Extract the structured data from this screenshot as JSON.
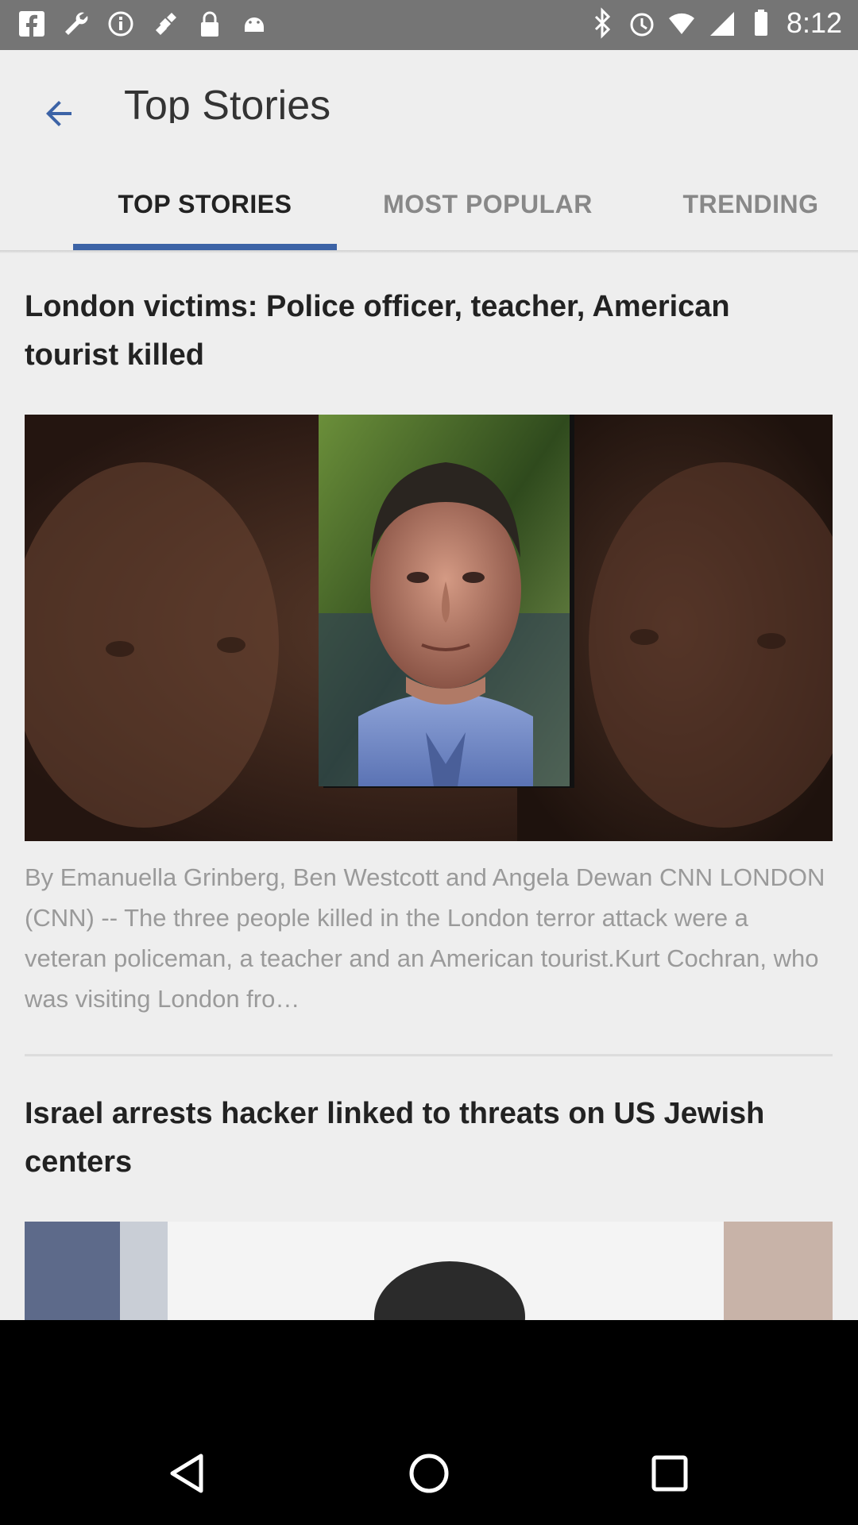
{
  "status_bar": {
    "time": "8:12",
    "left_icons": [
      "facebook-icon",
      "wrench-icon",
      "info-icon",
      "fake-gps-icon",
      "lock-icon",
      "android-icon"
    ],
    "right_icons": [
      "bluetooth-icon",
      "alarm-icon",
      "wifi-icon",
      "signal-icon",
      "battery-icon"
    ]
  },
  "app_bar": {
    "title": "Top Stories"
  },
  "tabs": [
    {
      "label": "TOP STORIES",
      "active": true
    },
    {
      "label": "MOST POPULAR",
      "active": false
    },
    {
      "label": "TRENDING",
      "active": false
    }
  ],
  "articles": [
    {
      "headline": "London victims: Police officer, teacher, American tourist killed",
      "summary": "By Emanuella Grinberg, Ben Westcott and Angela Dewan CNN LONDON (CNN) -- The three people killed in the London terror attack were a veteran policeman, a teacher and an American tourist.Kurt Cochran, who was visiting London fro…"
    },
    {
      "headline": "Israel arrests hacker linked to threats on US Jewish centers"
    }
  ],
  "colors": {
    "accent": "#3c63a6",
    "status_bar": "#757575",
    "background": "#eeeeee"
  }
}
